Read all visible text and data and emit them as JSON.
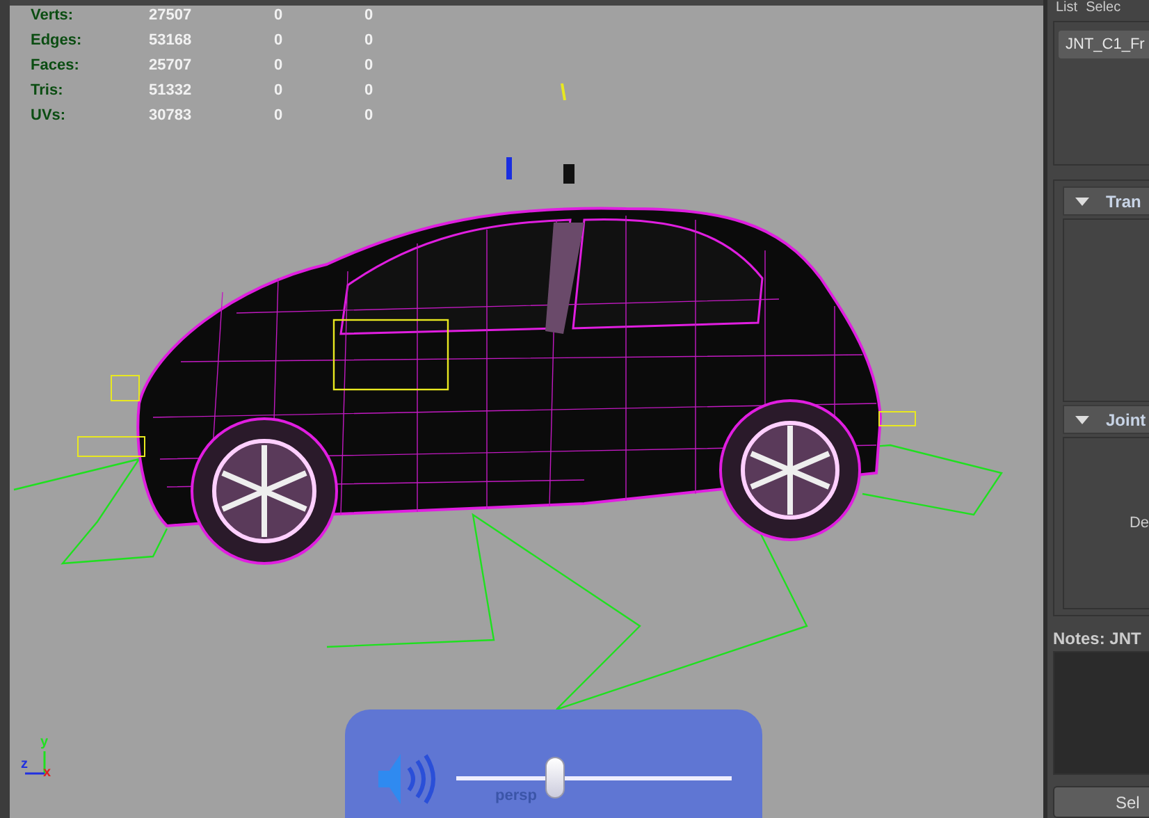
{
  "viewport": {
    "stats": [
      {
        "label": "Verts:",
        "values": [
          "27507",
          "0",
          "0"
        ]
      },
      {
        "label": "Edges:",
        "values": [
          "53168",
          "0",
          "0"
        ]
      },
      {
        "label": "Faces:",
        "values": [
          "25707",
          "0",
          "0"
        ]
      },
      {
        "label": "Tris:",
        "values": [
          "51332",
          "0",
          "0"
        ]
      },
      {
        "label": "UVs:",
        "values": [
          "30783",
          "0",
          "0"
        ]
      }
    ],
    "axis": {
      "y": "y",
      "z": "z",
      "x": "x"
    },
    "volume": {
      "level": 0.36,
      "caption": "persp"
    }
  },
  "side_panel": {
    "menu": [
      "List",
      "Selec"
    ],
    "node_name": "JNT_C1_Fr",
    "sections": [
      {
        "title": "Tran",
        "expanded": true
      },
      {
        "title": "Joint",
        "expanded": true,
        "body": "De"
      }
    ],
    "notes_label": "Notes: JNT",
    "button": "Sel"
  }
}
